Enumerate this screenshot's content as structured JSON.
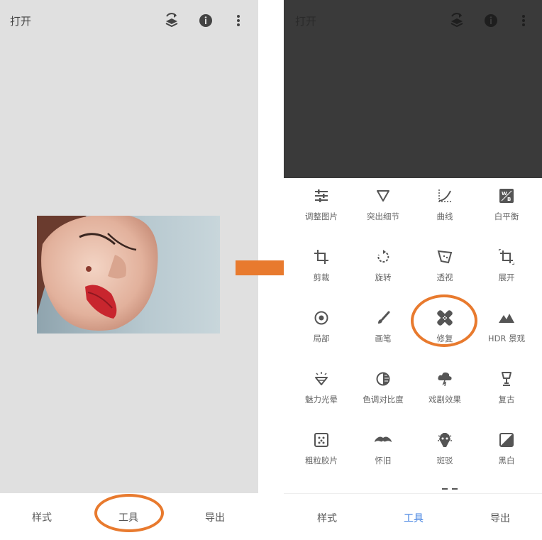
{
  "left": {
    "header": {
      "title": "打开"
    },
    "nav": {
      "styles": "样式",
      "tools": "工具",
      "export": "导出"
    }
  },
  "right": {
    "header": {
      "title": "打开"
    },
    "tools": [
      [
        "调整图片",
        "突出细节",
        "曲线",
        "白平衡"
      ],
      [
        "剪裁",
        "旋转",
        "透视",
        "展开"
      ],
      [
        "局部",
        "画笔",
        "修复",
        "HDR 景观"
      ],
      [
        "魅力光晕",
        "色调对比度",
        "戏剧效果",
        "复古"
      ],
      [
        "粗粒胶片",
        "怀旧",
        "斑驳",
        "黑白"
      ]
    ],
    "nav": {
      "styles": "样式",
      "tools": "工具",
      "export": "导出"
    }
  },
  "colors": {
    "accent_orange": "#e87a2e",
    "active_tab": "#3f7fe0",
    "dark_bg": "#3a3a3a",
    "canvas_bg": "#e0e0e0"
  },
  "icons": [
    "layers-sync-icon",
    "info-icon",
    "more-vert-icon",
    "tune-icon",
    "details-icon",
    "curves-icon",
    "white-balance-icon",
    "crop-icon",
    "rotate-icon",
    "perspective-icon",
    "expand-icon",
    "selective-icon",
    "brush-icon",
    "healing-icon",
    "hdr-icon",
    "glamour-glow-icon",
    "tonal-contrast-icon",
    "drama-icon",
    "vintage-icon",
    "grainy-film-icon",
    "retrolux-icon",
    "grunge-icon",
    "black-white-icon"
  ]
}
